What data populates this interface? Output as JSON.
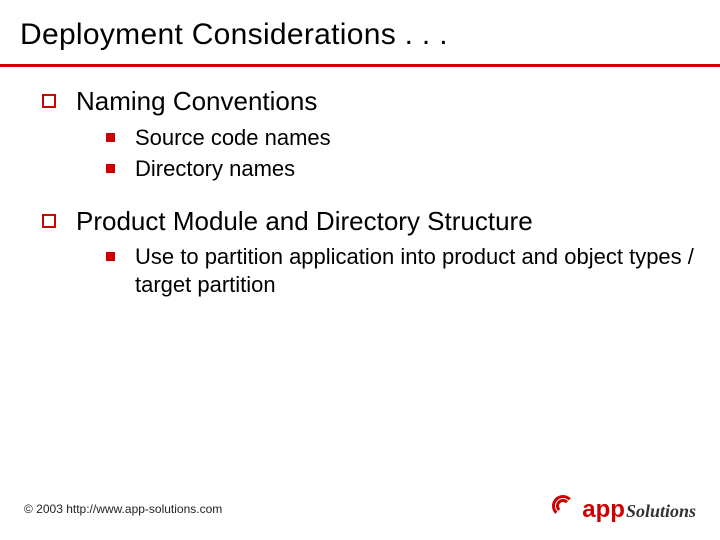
{
  "title": "Deployment Considerations . . .",
  "points": [
    {
      "text": "Naming Conventions",
      "children": [
        {
          "text": "Source code names"
        },
        {
          "text": "Directory names"
        }
      ]
    },
    {
      "text": "Product Module and Directory Structure",
      "children": [
        {
          "text": "Use to partition application into product and object types / target partition"
        }
      ]
    }
  ],
  "footer": {
    "copyright": "© 2003 http://www.app-solutions.com",
    "logo": {
      "part1": "app",
      "part2": "Solutions"
    }
  }
}
